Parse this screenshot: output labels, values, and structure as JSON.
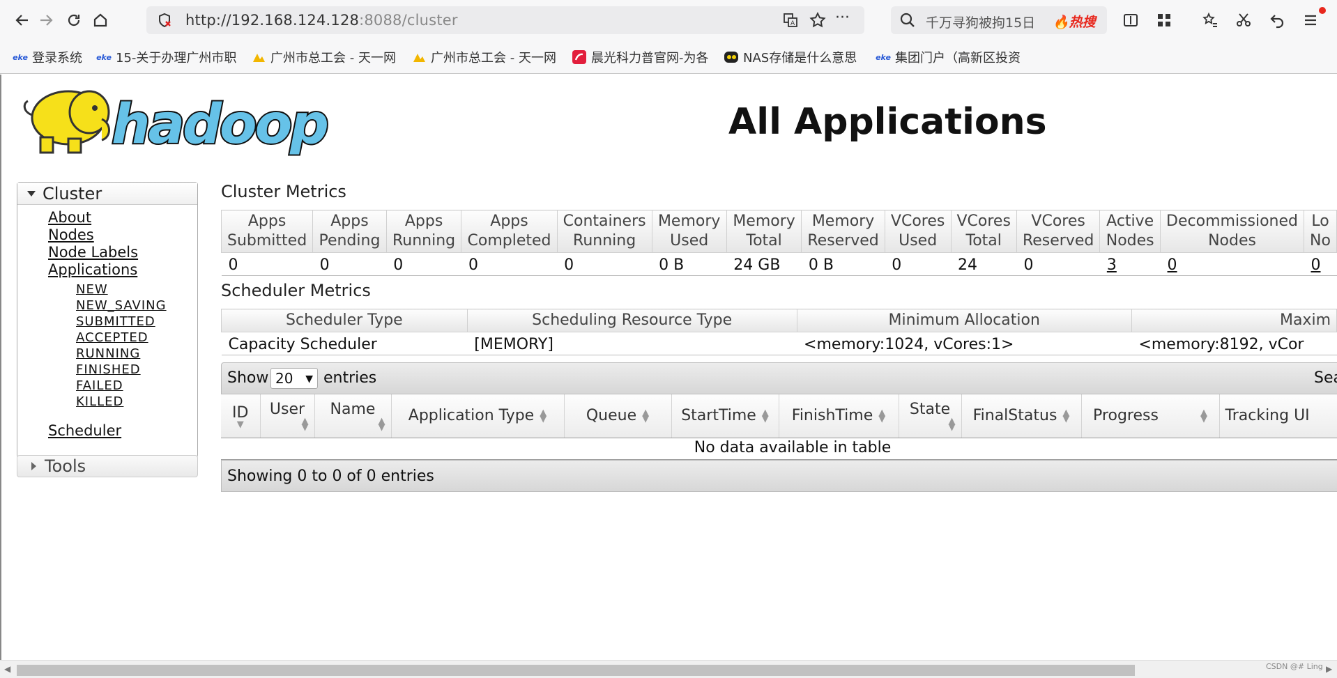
{
  "browser": {
    "url_main": "http://192.168.124.128",
    "url_rest": ":8088/cluster",
    "search_text": "千万寻狗被拘15日",
    "hot_label": "热搜"
  },
  "bookmarks": [
    {
      "label": "登录系统",
      "icon": "eke-icon"
    },
    {
      "label": "15-关于办理广州市职",
      "icon": "eke-icon"
    },
    {
      "label": "广州市总工会 - 天一网",
      "icon": "union-icon"
    },
    {
      "label": "广州市总工会 - 天一网",
      "icon": "union-icon"
    },
    {
      "label": "晨光科力普官网-为各",
      "icon": "colipu-icon"
    },
    {
      "label": "NAS存储是什么意思",
      "icon": "nas-icon"
    },
    {
      "label": "集团门户（高新区投资",
      "icon": "eke-icon"
    }
  ],
  "page": {
    "title": "All Applications",
    "logo_text": "hadoop"
  },
  "sidebar": {
    "cluster_label": "Cluster",
    "links": [
      "About",
      "Nodes",
      "Node Labels",
      "Applications"
    ],
    "states": [
      "NEW",
      "NEW_SAVING",
      "SUBMITTED",
      "ACCEPTED",
      "RUNNING",
      "FINISHED",
      "FAILED",
      "KILLED"
    ],
    "scheduler": "Scheduler",
    "tools_label": "Tools"
  },
  "cluster_metrics": {
    "title": "Cluster Metrics",
    "headers": [
      [
        "Apps",
        "Submitted"
      ],
      [
        "Apps",
        "Pending"
      ],
      [
        "Apps",
        "Running"
      ],
      [
        "Apps",
        "Completed"
      ],
      [
        "Containers",
        "Running"
      ],
      [
        "Memory",
        "Used"
      ],
      [
        "Memory",
        "Total"
      ],
      [
        "Memory",
        "Reserved"
      ],
      [
        "VCores",
        "Used"
      ],
      [
        "VCores",
        "Total"
      ],
      [
        "VCores",
        "Reserved"
      ],
      [
        "Active",
        "Nodes"
      ],
      [
        "Decommissioned",
        "Nodes"
      ],
      [
        "Lo",
        "No"
      ]
    ],
    "values": [
      "0",
      "0",
      "0",
      "0",
      "0",
      "0 B",
      "24 GB",
      "0 B",
      "0",
      "24",
      "0",
      "3",
      "0",
      "0"
    ]
  },
  "scheduler_metrics": {
    "title": "Scheduler Metrics",
    "headers": [
      "Scheduler Type",
      "Scheduling Resource Type",
      "Minimum Allocation",
      "Maxim"
    ],
    "values": [
      "Capacity Scheduler",
      "[MEMORY]",
      "<memory:1024, vCores:1>",
      "<memory:8192, vCor"
    ]
  },
  "apps_table": {
    "show_label": "Show",
    "entries_value": "20",
    "entries_label": "entries",
    "search_label": "Sea",
    "columns": [
      "ID",
      "User",
      "Name",
      "Application Type",
      "Queue",
      "StartTime",
      "FinishTime",
      "State",
      "FinalStatus",
      "Progress",
      "Tracking UI"
    ],
    "empty_message": "No data available in table",
    "footer": "Showing 0 to 0 of 0 entries"
  },
  "watermark": "CSDN @# Ling"
}
